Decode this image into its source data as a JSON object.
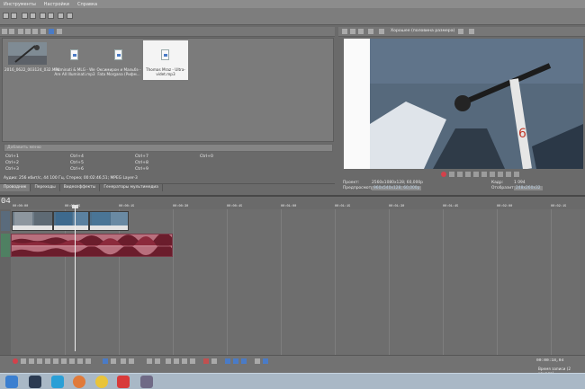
{
  "menu": [
    "Инструменты",
    "Настройки",
    "Справка"
  ],
  "media": {
    "items": [
      {
        "caption": "2016_0622_003124_032.MP4",
        "type": "video"
      },
      {
        "caption": "Illuminati & MLG - We Are All Illuminati.mp3",
        "type": "audio"
      },
      {
        "caption": "Оксимирон и Мальбэ - Fata Morgana (Рифм...",
        "type": "audio"
      },
      {
        "caption": "Thomas Mraz - Ultra-videt.mp3",
        "type": "audio",
        "selected": true
      }
    ],
    "search_placeholder": "Добавить меню",
    "shortcuts": [
      "Ctrl+1",
      "Ctrl+4",
      "Ctrl+7",
      "Ctrl+0",
      "Ctrl+2",
      "Ctrl+5",
      "Ctrl+8",
      "Ctrl+3",
      "Ctrl+6",
      "Ctrl+9"
    ],
    "audio_info": "Аудио: 256 кбит/с, 44 100 Гц, Стерео; 00:02:46,51; MPEG Layer-3"
  },
  "tabs": [
    "Проводник",
    "Переходы",
    "Видеоэффекты",
    "Генераторы мультимедиа"
  ],
  "preview": {
    "mode_label": "Хорошее (половина размера)",
    "project_label": "Проект:",
    "project_value": "2560x1080x128; 60,000p",
    "preview_label": "Предпросмотр:",
    "preview_value": "960x540x128; 60,000p",
    "frame_label": "Кадр:",
    "frame_value": "1 094",
    "display_label": "Отобразить:",
    "display_value": "248x260x32"
  },
  "timeline": {
    "timecode": "04",
    "ruler_labels": [
      "00:00:00",
      "00:00:05",
      "00:00:15",
      "00:00:30",
      "00:00:45",
      "00:01:00",
      "00:01:15",
      "00:01:30",
      "00:01:45",
      "00:02:00",
      "00:02:15",
      "00:02:30"
    ]
  },
  "bottom": {
    "time": "00:00:18,04",
    "status": "Время записи (2 канала)"
  },
  "colors": {
    "audio_clip": "#b86f7d",
    "waveform": "#6b1d2c",
    "video_clip": "#4d6f8a"
  }
}
